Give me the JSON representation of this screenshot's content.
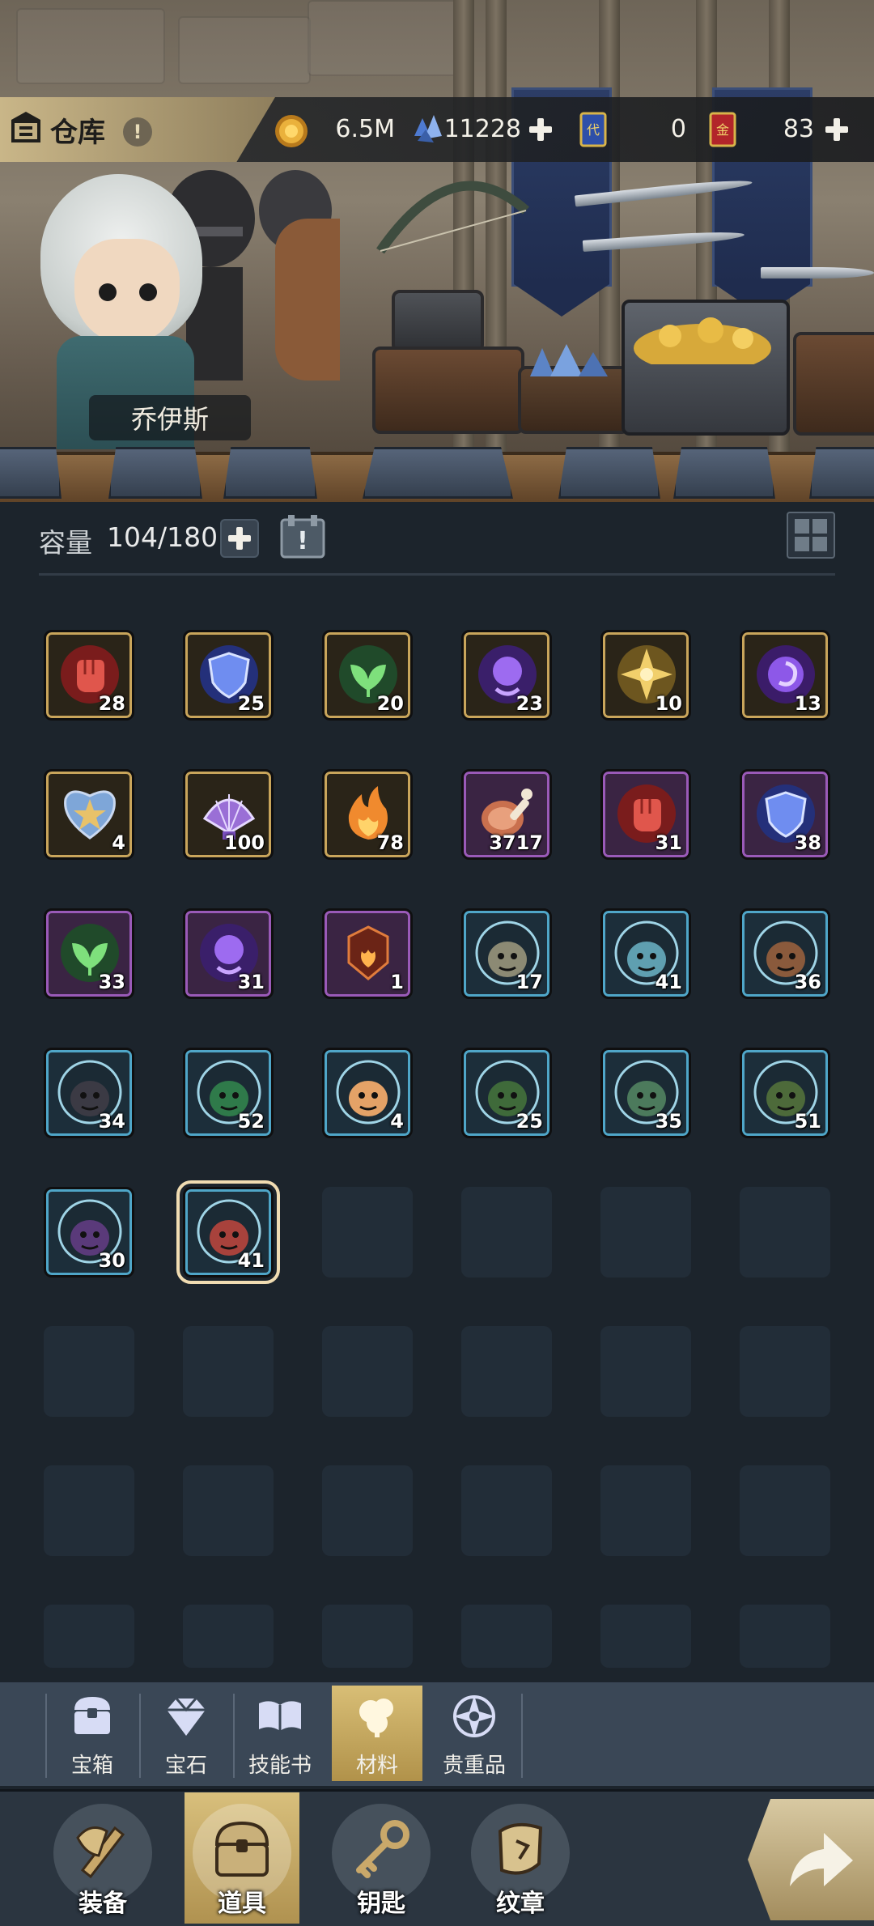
{
  "header": {
    "title": "仓库",
    "hint_icon": "exclamation-icon",
    "currencies": [
      {
        "name": "gold",
        "icon": "gold-coin-icon",
        "value": "6.5M",
        "has_add": false
      },
      {
        "name": "crystal",
        "icon": "blue-crystal-icon",
        "value": "11228",
        "has_add": true
      },
      {
        "name": "blue-ticket",
        "icon": "blue-ticket-icon",
        "value": "0",
        "has_add": false
      },
      {
        "name": "red-ticket",
        "icon": "red-ticket-icon",
        "value": "83",
        "has_add": true
      }
    ]
  },
  "hero": {
    "name": "乔伊斯"
  },
  "capacity": {
    "label": "容量",
    "value": "104/180"
  },
  "items": [
    {
      "rarity": "gold",
      "icon": "red-fist-icon",
      "count": "28"
    },
    {
      "rarity": "gold",
      "icon": "blue-shield-icon",
      "count": "25"
    },
    {
      "rarity": "gold",
      "icon": "green-leaf-icon",
      "count": "20"
    },
    {
      "rarity": "gold",
      "icon": "purple-orb-icon",
      "count": "23"
    },
    {
      "rarity": "gold",
      "icon": "gold-compass-icon",
      "count": "10"
    },
    {
      "rarity": "gold",
      "icon": "purple-swirl-icon",
      "count": "13"
    },
    {
      "rarity": "gold",
      "icon": "star-heart-icon",
      "count": "4"
    },
    {
      "rarity": "gold",
      "icon": "purple-shell-icon",
      "count": "100"
    },
    {
      "rarity": "gold",
      "icon": "fire-spirit-icon",
      "count": "78"
    },
    {
      "rarity": "purple",
      "icon": "meat-leg-icon",
      "count": "3717"
    },
    {
      "rarity": "purple",
      "icon": "red-fist-icon",
      "count": "31"
    },
    {
      "rarity": "purple",
      "icon": "blue-shield-icon",
      "count": "38"
    },
    {
      "rarity": "purple",
      "icon": "green-leaf-icon",
      "count": "33"
    },
    {
      "rarity": "purple",
      "icon": "purple-orb-icon",
      "count": "31"
    },
    {
      "rarity": "purple",
      "icon": "flame-emblem-icon",
      "count": "1"
    },
    {
      "rarity": "cyan",
      "icon": "monster-wizard-avatar",
      "count": "17"
    },
    {
      "rarity": "cyan",
      "icon": "monster-aqua-avatar",
      "count": "41"
    },
    {
      "rarity": "cyan",
      "icon": "monster-beast-avatar",
      "count": "36"
    },
    {
      "rarity": "cyan",
      "icon": "monster-shadow-avatar",
      "count": "34"
    },
    {
      "rarity": "cyan",
      "icon": "monster-goblin-avatar",
      "count": "52"
    },
    {
      "rarity": "cyan",
      "icon": "monster-girl-avatar",
      "count": "4"
    },
    {
      "rarity": "cyan",
      "icon": "monster-bush-avatar",
      "count": "25"
    },
    {
      "rarity": "cyan",
      "icon": "monster-ogre-avatar",
      "count": "35"
    },
    {
      "rarity": "cyan",
      "icon": "monster-treant-avatar",
      "count": "51"
    },
    {
      "rarity": "cyan",
      "icon": "monster-demon-avatar",
      "count": "30"
    },
    {
      "rarity": "cyan",
      "icon": "monster-dragon-avatar",
      "count": "41"
    }
  ],
  "selected_index": 25,
  "categories": [
    {
      "label": "宝箱",
      "icon": "chest-icon",
      "active": false
    },
    {
      "label": "宝石",
      "icon": "gem-icon",
      "active": false
    },
    {
      "label": "技能书",
      "icon": "book-icon",
      "active": false
    },
    {
      "label": "材料",
      "icon": "material-icon",
      "active": true
    },
    {
      "label": "贵重品",
      "icon": "valuable-icon",
      "active": false
    }
  ],
  "nav": [
    {
      "label": "装备",
      "icon": "equipment-icon",
      "active": false
    },
    {
      "label": "道具",
      "icon": "items-icon",
      "active": true
    },
    {
      "label": "钥匙",
      "icon": "key-icon",
      "active": false
    },
    {
      "label": "纹章",
      "icon": "emblem-icon",
      "active": false
    }
  ],
  "go_button_icon": "arrow-right-icon",
  "colors": {
    "gold_frame": "#c9a55b",
    "purple_frame": "#9a5ab8",
    "cyan_frame": "#4fa6c8",
    "active_tab": "#d4b86e",
    "background": "#1c242c"
  }
}
